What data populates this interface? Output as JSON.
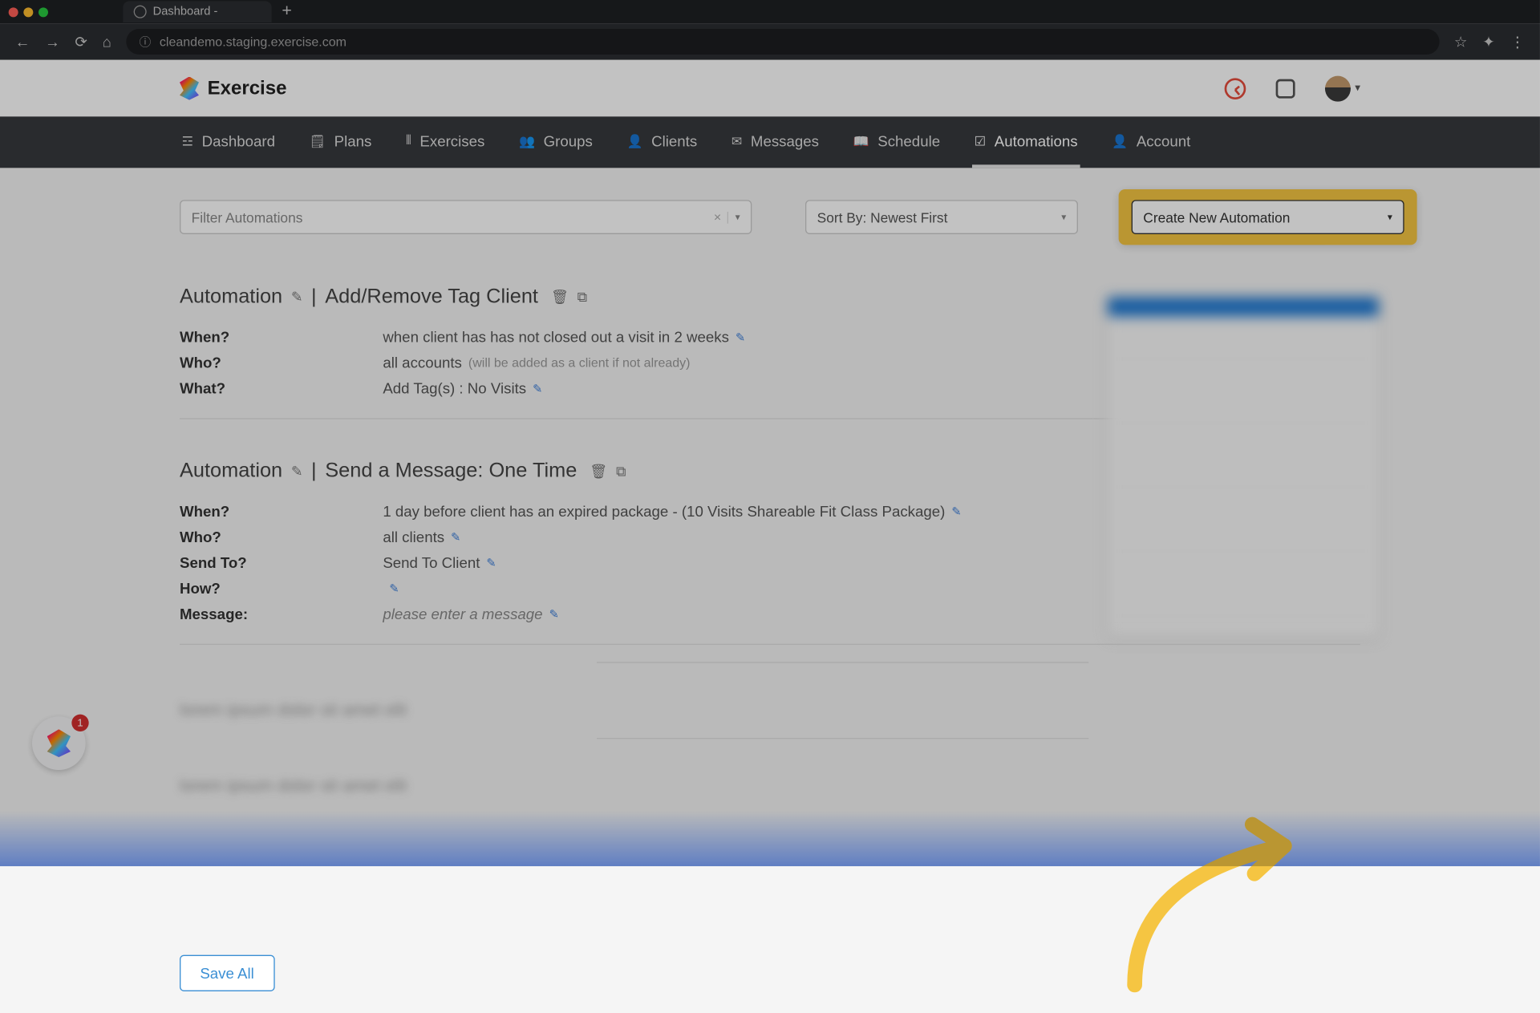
{
  "browser": {
    "tab_title": "Dashboard -",
    "url": "cleandemo.staging.exercise.com"
  },
  "header": {
    "brand": "Exercise"
  },
  "nav": {
    "items": [
      {
        "label": "Dashboard",
        "icon": "☲"
      },
      {
        "label": "Plans",
        "icon": "🗒"
      },
      {
        "label": "Exercises",
        "icon": "⫴"
      },
      {
        "label": "Groups",
        "icon": "👥"
      },
      {
        "label": "Clients",
        "icon": "👤"
      },
      {
        "label": "Messages",
        "icon": "✉"
      },
      {
        "label": "Schedule",
        "icon": "📖"
      },
      {
        "label": "Automations",
        "icon": "☑"
      },
      {
        "label": "Account",
        "icon": "👤"
      }
    ],
    "active_index": 7
  },
  "toolbar": {
    "filter_placeholder": "Filter Automations",
    "sort_label": "Sort By: Newest First",
    "create_label": "Create New Automation"
  },
  "automations": [
    {
      "title_prefix": "Automation",
      "title_suffix": "Add/Remove Tag Client",
      "rows": [
        {
          "label": "When?",
          "value": "when client has has not closed out a visit in 2 weeks",
          "sub": "",
          "editable": true
        },
        {
          "label": "Who?",
          "value": "all accounts",
          "sub": "(will be added as a client if not already)",
          "editable": false
        },
        {
          "label": "What?",
          "value": "Add Tag(s) : No Visits",
          "sub": "",
          "editable": true
        }
      ]
    },
    {
      "title_prefix": "Automation",
      "title_suffix": "Send a Message: One Time",
      "rows": [
        {
          "label": "When?",
          "value": "1 day before client has an expired package - (10 Visits Shareable Fit Class Package)",
          "sub": "",
          "editable": true
        },
        {
          "label": "Who?",
          "value": "all clients",
          "sub": "",
          "editable": true
        },
        {
          "label": "Send To?",
          "value": "Send To Client",
          "sub": "",
          "editable": true
        },
        {
          "label": "How?",
          "value": "",
          "sub": "",
          "editable": true
        },
        {
          "label": "Message:",
          "value": "please enter a message",
          "sub": "",
          "editable": true,
          "italic": true
        }
      ]
    }
  ],
  "blurred_lines": [
    "lorem ipsum dolor sit amet elit",
    "lorem ipsum dolor sit amet elit"
  ],
  "save_all_label": "Save All",
  "badge_count": "1"
}
